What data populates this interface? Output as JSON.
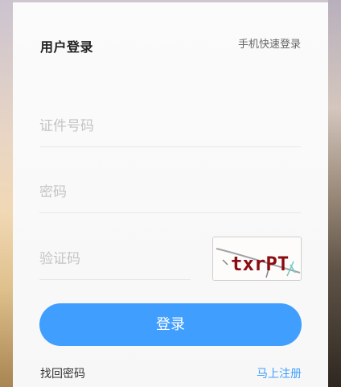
{
  "login": {
    "title": "用户登录",
    "quick_login_link": "手机快速登录",
    "id_field": {
      "placeholder": "证件号码",
      "value": ""
    },
    "password_field": {
      "placeholder": "密码",
      "value": ""
    },
    "captcha_field": {
      "placeholder": "验证码",
      "value": ""
    },
    "captcha_image_text": "txrPT",
    "submit_label": "登录",
    "forgot_password_link": "找回密码",
    "register_link": "马上注册"
  },
  "colors": {
    "accent": "#409eff",
    "title": "#222222",
    "placeholder": "#c4c4c4",
    "captcha_text": "#8b0d12"
  }
}
